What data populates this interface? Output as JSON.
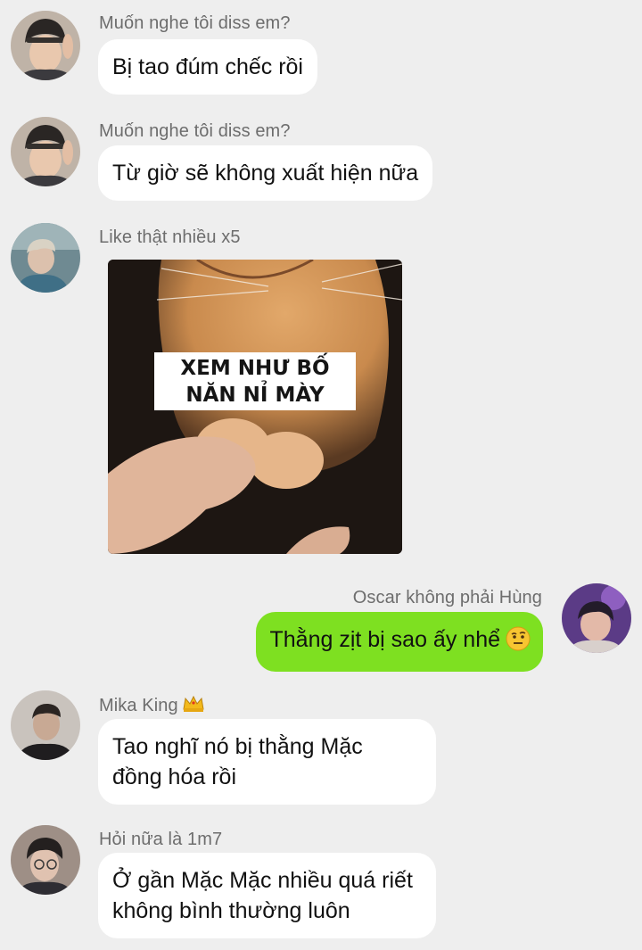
{
  "messages": [
    {
      "sender": "Muốn nghe tôi diss em?",
      "text": "Bị tao đúm chếc rồi",
      "avatar": "avatar-beanie-boy"
    },
    {
      "sender": "Muốn nghe tôi diss em?",
      "text": "Từ giờ sẽ không xuất hiện nữa",
      "avatar": "avatar-beanie-boy"
    },
    {
      "sender": "Like thật nhiều x5",
      "image_caption_line1": "XEM NHƯ BỐ",
      "image_caption_line2": "NĂN NỈ MÀY",
      "avatar": "avatar-blond-boy"
    },
    {
      "sender": "Oscar không phải Hùng",
      "text": "Thằng zịt bị sao ấy nhể",
      "emoji": "raised-eyebrow-emoji",
      "avatar": "avatar-purple-boy"
    },
    {
      "sender": "Mika King",
      "sender_badge": "crown-icon",
      "text_line1": "Tao nghĩ nó bị thằng Mặc",
      "text_line2": "đồng hóa rồi",
      "avatar": "avatar-dark-boy"
    },
    {
      "sender": "Hỏi nữa là 1m7",
      "text_line1": "Ở gần Mặc Mặc nhiều quá riết",
      "text_line2": "không bình thường luôn",
      "avatar": "avatar-glasses-boy"
    }
  ],
  "colors": {
    "background": "#eeeeee",
    "incoming_bubble": "#ffffff",
    "outgoing_bubble": "#7ee021",
    "sender_text": "#6d6d6d"
  }
}
